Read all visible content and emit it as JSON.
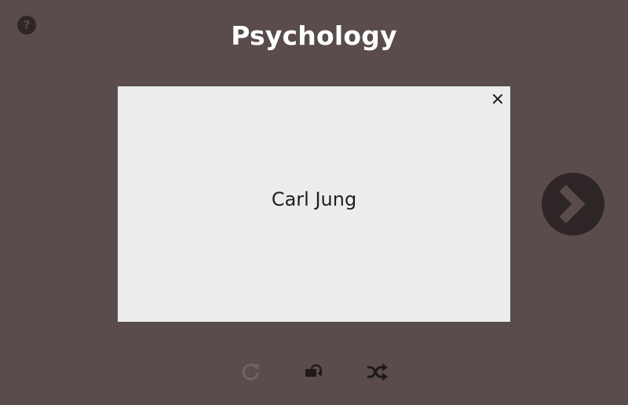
{
  "app": {
    "title": "Psychology"
  },
  "card": {
    "text": "Carl Jung"
  },
  "help": {
    "label": "?"
  },
  "colors": {
    "background": "#5a4c4c",
    "card": "#ececec",
    "button_dark": "#2e2626",
    "title": "#ffffff",
    "icon_active": "#1f1a1a",
    "icon_disabled": "#6e6262"
  },
  "icons": {
    "help": "question-mark-icon",
    "close": "close-icon",
    "next": "chevron-right-icon",
    "restart": "restart-icon",
    "flip": "flip-card-icon",
    "shuffle": "shuffle-icon"
  },
  "controls": {
    "restart_enabled": false,
    "flip_enabled": true,
    "shuffle_enabled": true
  }
}
